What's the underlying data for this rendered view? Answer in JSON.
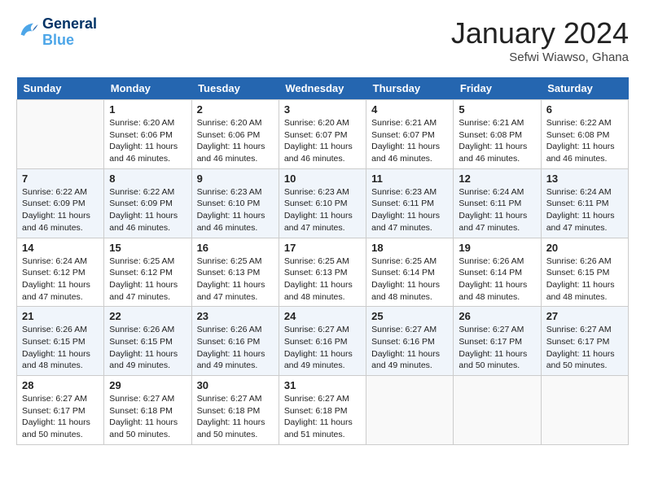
{
  "header": {
    "logo_line1": "General",
    "logo_line2": "Blue",
    "month": "January 2024",
    "location": "Sefwi Wiawso, Ghana"
  },
  "days": [
    "Sunday",
    "Monday",
    "Tuesday",
    "Wednesday",
    "Thursday",
    "Friday",
    "Saturday"
  ],
  "weeks": [
    [
      {
        "date": "",
        "info": ""
      },
      {
        "date": "1",
        "info": "Sunrise: 6:20 AM\nSunset: 6:06 PM\nDaylight: 11 hours and 46 minutes."
      },
      {
        "date": "2",
        "info": "Sunrise: 6:20 AM\nSunset: 6:06 PM\nDaylight: 11 hours and 46 minutes."
      },
      {
        "date": "3",
        "info": "Sunrise: 6:20 AM\nSunset: 6:07 PM\nDaylight: 11 hours and 46 minutes."
      },
      {
        "date": "4",
        "info": "Sunrise: 6:21 AM\nSunset: 6:07 PM\nDaylight: 11 hours and 46 minutes."
      },
      {
        "date": "5",
        "info": "Sunrise: 6:21 AM\nSunset: 6:08 PM\nDaylight: 11 hours and 46 minutes."
      },
      {
        "date": "6",
        "info": "Sunrise: 6:22 AM\nSunset: 6:08 PM\nDaylight: 11 hours and 46 minutes."
      }
    ],
    [
      {
        "date": "7",
        "info": "Sunrise: 6:22 AM\nSunset: 6:09 PM\nDaylight: 11 hours and 46 minutes."
      },
      {
        "date": "8",
        "info": "Sunrise: 6:22 AM\nSunset: 6:09 PM\nDaylight: 11 hours and 46 minutes."
      },
      {
        "date": "9",
        "info": "Sunrise: 6:23 AM\nSunset: 6:10 PM\nDaylight: 11 hours and 46 minutes."
      },
      {
        "date": "10",
        "info": "Sunrise: 6:23 AM\nSunset: 6:10 PM\nDaylight: 11 hours and 47 minutes."
      },
      {
        "date": "11",
        "info": "Sunrise: 6:23 AM\nSunset: 6:11 PM\nDaylight: 11 hours and 47 minutes."
      },
      {
        "date": "12",
        "info": "Sunrise: 6:24 AM\nSunset: 6:11 PM\nDaylight: 11 hours and 47 minutes."
      },
      {
        "date": "13",
        "info": "Sunrise: 6:24 AM\nSunset: 6:11 PM\nDaylight: 11 hours and 47 minutes."
      }
    ],
    [
      {
        "date": "14",
        "info": "Sunrise: 6:24 AM\nSunset: 6:12 PM\nDaylight: 11 hours and 47 minutes."
      },
      {
        "date": "15",
        "info": "Sunrise: 6:25 AM\nSunset: 6:12 PM\nDaylight: 11 hours and 47 minutes."
      },
      {
        "date": "16",
        "info": "Sunrise: 6:25 AM\nSunset: 6:13 PM\nDaylight: 11 hours and 47 minutes."
      },
      {
        "date": "17",
        "info": "Sunrise: 6:25 AM\nSunset: 6:13 PM\nDaylight: 11 hours and 48 minutes."
      },
      {
        "date": "18",
        "info": "Sunrise: 6:25 AM\nSunset: 6:14 PM\nDaylight: 11 hours and 48 minutes."
      },
      {
        "date": "19",
        "info": "Sunrise: 6:26 AM\nSunset: 6:14 PM\nDaylight: 11 hours and 48 minutes."
      },
      {
        "date": "20",
        "info": "Sunrise: 6:26 AM\nSunset: 6:15 PM\nDaylight: 11 hours and 48 minutes."
      }
    ],
    [
      {
        "date": "21",
        "info": "Sunrise: 6:26 AM\nSunset: 6:15 PM\nDaylight: 11 hours and 48 minutes."
      },
      {
        "date": "22",
        "info": "Sunrise: 6:26 AM\nSunset: 6:15 PM\nDaylight: 11 hours and 49 minutes."
      },
      {
        "date": "23",
        "info": "Sunrise: 6:26 AM\nSunset: 6:16 PM\nDaylight: 11 hours and 49 minutes."
      },
      {
        "date": "24",
        "info": "Sunrise: 6:27 AM\nSunset: 6:16 PM\nDaylight: 11 hours and 49 minutes."
      },
      {
        "date": "25",
        "info": "Sunrise: 6:27 AM\nSunset: 6:16 PM\nDaylight: 11 hours and 49 minutes."
      },
      {
        "date": "26",
        "info": "Sunrise: 6:27 AM\nSunset: 6:17 PM\nDaylight: 11 hours and 50 minutes."
      },
      {
        "date": "27",
        "info": "Sunrise: 6:27 AM\nSunset: 6:17 PM\nDaylight: 11 hours and 50 minutes."
      }
    ],
    [
      {
        "date": "28",
        "info": "Sunrise: 6:27 AM\nSunset: 6:17 PM\nDaylight: 11 hours and 50 minutes."
      },
      {
        "date": "29",
        "info": "Sunrise: 6:27 AM\nSunset: 6:18 PM\nDaylight: 11 hours and 50 minutes."
      },
      {
        "date": "30",
        "info": "Sunrise: 6:27 AM\nSunset: 6:18 PM\nDaylight: 11 hours and 50 minutes."
      },
      {
        "date": "31",
        "info": "Sunrise: 6:27 AM\nSunset: 6:18 PM\nDaylight: 11 hours and 51 minutes."
      },
      {
        "date": "",
        "info": ""
      },
      {
        "date": "",
        "info": ""
      },
      {
        "date": "",
        "info": ""
      }
    ]
  ]
}
